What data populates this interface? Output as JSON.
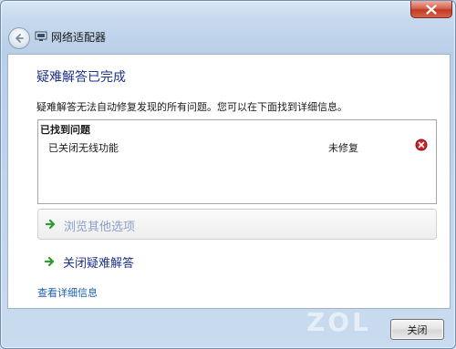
{
  "window": {
    "title": "网络适配器"
  },
  "main": {
    "heading": "疑难解答已完成",
    "description": "疑难解答无法自动修复发现的所有问题。您可以在下面找到详细信息。",
    "issues": {
      "header": "已找到问题",
      "items": [
        {
          "name": "已关闭无线功能",
          "status": "未修复",
          "status_icon": "error-icon"
        }
      ]
    },
    "options": {
      "browse_label": "浏览其他选项",
      "close_troubleshooter_label": "关闭疑难解答"
    },
    "details_link": "查看详细信息"
  },
  "footer": {
    "close_label": "关闭"
  },
  "watermark": "ZOL"
}
